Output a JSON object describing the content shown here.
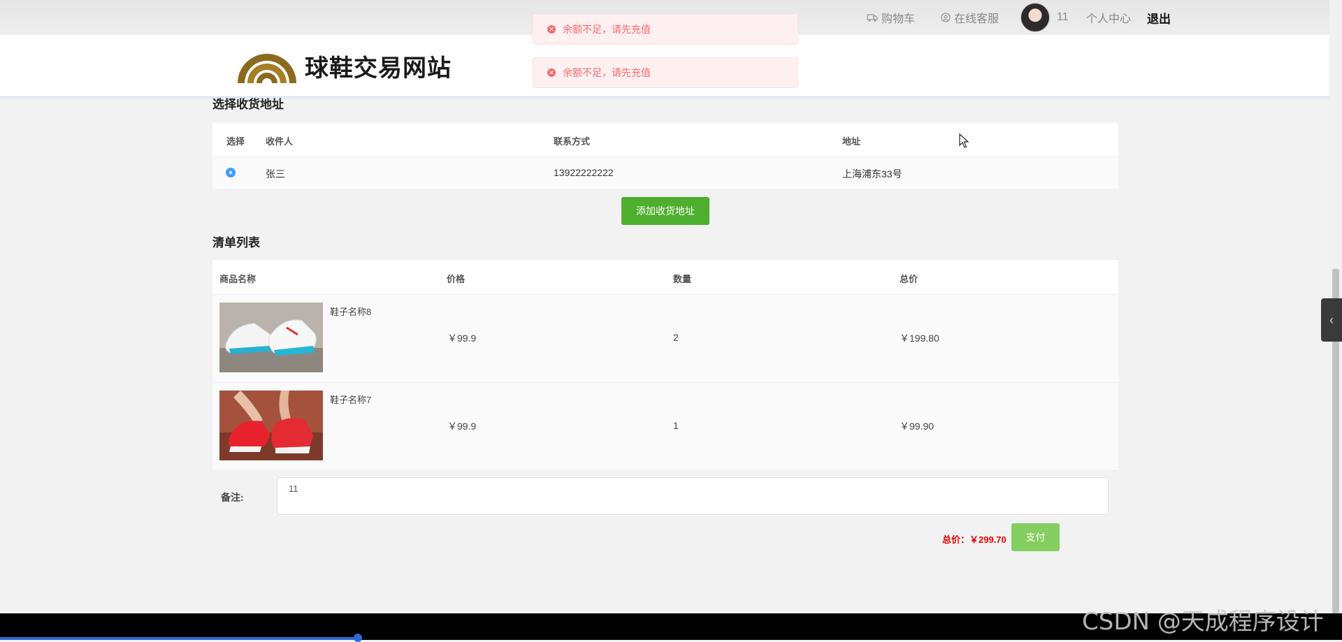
{
  "topnav": {
    "cart": "购物车",
    "service": "在线客服",
    "username": "11",
    "profile": "个人中心",
    "logout": "退出"
  },
  "site": {
    "title": "球鞋交易网站"
  },
  "toasts": [
    {
      "text": "余额不足，请先充值"
    },
    {
      "text": "余额不足，请先充值"
    }
  ],
  "address_section": {
    "title": "选择收货地址",
    "columns": [
      "选择",
      "收件人",
      "联系方式",
      "地址"
    ],
    "rows": [
      {
        "selected": true,
        "name": "张三",
        "phone": "13922222222",
        "address": "上海浦东33号"
      }
    ],
    "add_button": "添加收货地址"
  },
  "order_section": {
    "title": "清单列表",
    "columns": [
      "商品名称",
      "价格",
      "数量",
      "总价"
    ],
    "items": [
      {
        "name": "鞋子名称8",
        "price": "￥99.9",
        "qty": "2",
        "total": "￥199.80",
        "image": "white-blue-sneaker"
      },
      {
        "name": "鞋子名称7",
        "price": "￥99.9",
        "qty": "1",
        "total": "￥99.90",
        "image": "red-sneaker"
      }
    ]
  },
  "remark": {
    "label": "备注:",
    "value": "11"
  },
  "checkout": {
    "total": "总价：￥299.70",
    "pay_label": "支付"
  },
  "watermark": "CSDN @天成程序设计",
  "colors": {
    "accent_green": "#4eae2d",
    "pay_green": "#85ce61",
    "error_red": "#f56c6c",
    "radio_blue": "#409eff"
  }
}
